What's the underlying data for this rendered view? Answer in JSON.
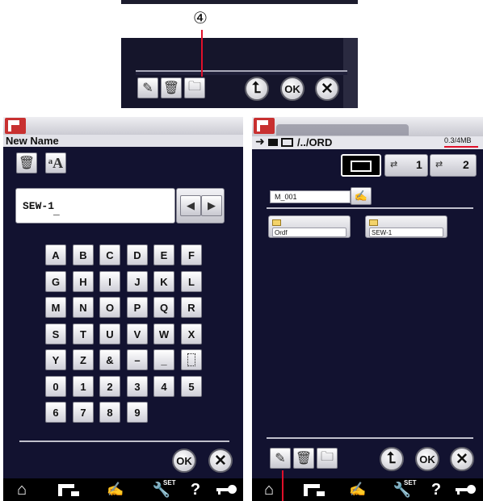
{
  "callout": {
    "number": "④"
  },
  "left": {
    "title": "New Name",
    "name_value": "SEW-1",
    "cursor": "_",
    "keys": [
      "A",
      "B",
      "C",
      "D",
      "E",
      "F",
      "G",
      "H",
      "I",
      "J",
      "K",
      "L",
      "M",
      "N",
      "O",
      "P",
      "Q",
      "R",
      "S",
      "T",
      "U",
      "V",
      "W",
      "X",
      "Y",
      "Z",
      "&",
      "–",
      "_",
      " ",
      "0",
      "1",
      "2",
      "3",
      "4",
      "5",
      "6",
      "7",
      "8",
      "9"
    ],
    "ok_label": "OK",
    "close_label": "✕"
  },
  "right": {
    "path": "/../ORD",
    "memory": "0.3/4MB",
    "usb1": "1",
    "usb2": "2",
    "file_name": "M_001",
    "folders": [
      "Ordf",
      "SEW-1"
    ],
    "ok_label": "OK",
    "close_label": "✕"
  },
  "top": {
    "ok_label": "OK",
    "close_label": "✕"
  },
  "nav": {
    "set_label": "SET",
    "help_label": "?"
  },
  "colors": {
    "screen": "#121230",
    "accent_red": "#e0102a",
    "machine_red": "#c83030"
  }
}
